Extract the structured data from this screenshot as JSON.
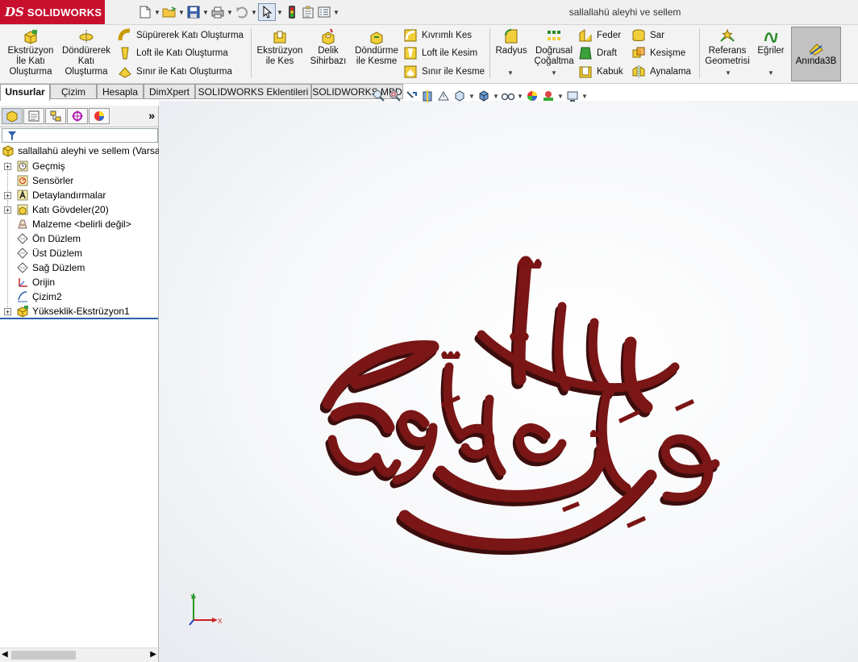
{
  "app": {
    "brand": "SOLIDWORKS",
    "logo_mark": "DS",
    "document_title": "sallallahü aleyhi ve sellem"
  },
  "colors": {
    "brand_red": "#c8102e",
    "model_color": "#7a1414",
    "accent_blue": "#2b5fad"
  },
  "quick_access": [
    {
      "name": "new-icon"
    },
    {
      "name": "open-icon"
    },
    {
      "name": "save-icon"
    },
    {
      "name": "print-icon"
    },
    {
      "name": "undo-icon"
    },
    {
      "name": "select-icon"
    },
    {
      "name": "rebuild-icon"
    },
    {
      "name": "file-properties-icon"
    },
    {
      "name": "options-icon"
    }
  ],
  "ribbon": {
    "extrude_boss": "Ekstrüzyon\nİle Katı\nOluşturma",
    "revolve_boss": "Döndürerek\nKatı\nOluşturma",
    "swept_boss": "Süpürerek Katı Oluşturma",
    "loft_boss": "Loft ile Katı Oluşturma",
    "boundary_boss": "Sınır ile Katı Oluşturma",
    "extrude_cut": "Ekstrüzyon\nile Kes",
    "hole_wizard": "Delik\nSihirbazı",
    "revolve_cut": "Döndürme\nile Kesme",
    "swept_cut": "Kıvrımlı Kes",
    "loft_cut": "Loft ile Kesim",
    "boundary_cut": "Sınır ile Kesme",
    "fillet": "Radyus",
    "linear_pattern": "Doğrusal\nÇoğaltma",
    "rib": "Feder",
    "draft": "Draft",
    "shell": "Kabuk",
    "wrap": "Sar",
    "intersect": "Kesişme",
    "mirror": "Aynalama",
    "reference_geometry": "Referans\nGeometrisi",
    "curves": "Eğriler",
    "instant3d": "Anında3B"
  },
  "tabs": [
    "Unsurlar",
    "Çizim",
    "Hesapla",
    "DimXpert",
    "SOLIDWORKS Eklentileri",
    "SOLIDWORKS MBD"
  ],
  "active_tab": "Unsurlar",
  "feature_tree": {
    "root": "sallallahü aleyhi ve sellem  (Varsa",
    "items": [
      {
        "label": "Geçmiş",
        "icon": "history-icon",
        "expandable": true
      },
      {
        "label": "Sensörler",
        "icon": "sensor-icon",
        "expandable": false
      },
      {
        "label": "Detaylandırmalar",
        "icon": "annotations-icon",
        "expandable": true
      },
      {
        "label": "Katı Gövdeler(20)",
        "icon": "solid-bodies-icon",
        "expandable": true
      },
      {
        "label": "Malzeme <belirli değil>",
        "icon": "material-icon",
        "expandable": false
      },
      {
        "label": "Ön Düzlem",
        "icon": "plane-icon",
        "expandable": false
      },
      {
        "label": "Üst Düzlem",
        "icon": "plane-icon",
        "expandable": false
      },
      {
        "label": "Sağ Düzlem",
        "icon": "plane-icon",
        "expandable": false
      },
      {
        "label": "Orijin",
        "icon": "origin-icon",
        "expandable": false
      },
      {
        "label": "Çizim2",
        "icon": "sketch-icon",
        "expandable": false
      },
      {
        "label": "Yükseklik-Ekstrüzyon1",
        "icon": "extrude-feature-icon",
        "expandable": true
      }
    ]
  },
  "triad": {
    "x_label": "X",
    "y_label": "Y"
  }
}
